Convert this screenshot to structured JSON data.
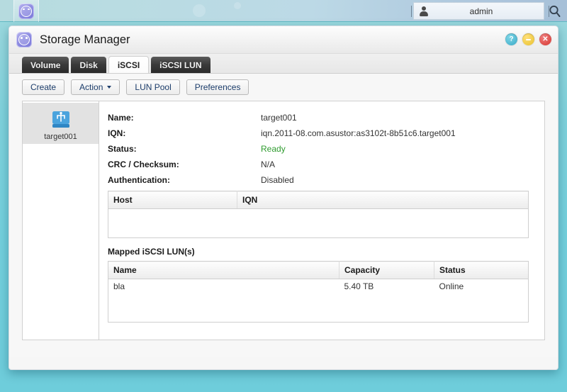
{
  "taskbar": {
    "app_icon": "adm-circle-icon",
    "user": {
      "icon": "user-icon",
      "name": "admin"
    },
    "search_icon": "search-icon"
  },
  "window": {
    "title": "Storage Manager",
    "icon": "storage-manager-icon",
    "controls": {
      "help": "?",
      "minimize": "–",
      "close": "✕"
    }
  },
  "tabs": [
    {
      "label": "Volume",
      "active": false
    },
    {
      "label": "Disk",
      "active": false
    },
    {
      "label": "iSCSI",
      "active": true
    },
    {
      "label": "iSCSI LUN",
      "active": false
    }
  ],
  "toolbar": {
    "create_label": "Create",
    "action_label": "Action",
    "lun_pool_label": "LUN Pool",
    "preferences_label": "Preferences"
  },
  "sidebar": {
    "items": [
      {
        "label": "target001",
        "icon": "iscsi-target-icon",
        "selected": true
      }
    ]
  },
  "details": {
    "rows": [
      {
        "label": "Name:",
        "value": "target001",
        "state": ""
      },
      {
        "label": "IQN:",
        "value": "iqn.2011-08.com.asustor:as3102t-8b51c6.target001",
        "state": ""
      },
      {
        "label": "Status:",
        "value": "Ready",
        "state": "ok"
      },
      {
        "label": "CRC / Checksum:",
        "value": "N/A",
        "state": ""
      },
      {
        "label": "Authentication:",
        "value": "Disabled",
        "state": ""
      }
    ]
  },
  "hosts_table": {
    "columns": [
      "Host",
      "IQN"
    ],
    "rows": []
  },
  "lun_section": {
    "title": "Mapped iSCSI LUN(s)",
    "columns": [
      "Name",
      "Capacity",
      "Status"
    ],
    "rows": [
      {
        "name": "bla",
        "capacity": "5.40 TB",
        "status": "Online"
      }
    ]
  },
  "colors": {
    "desktop": "#74d0dd",
    "taskbar": "#b6dbdf",
    "status_ok": "#2e9b2e",
    "tab_active_bg": "#ffffff",
    "tab_bg": "#2b2b2b",
    "accent_icon": "#4aa3dd",
    "close_btn": "#d6352f",
    "min_btn": "#e8c12e",
    "help_btn": "#3aa9c6"
  }
}
